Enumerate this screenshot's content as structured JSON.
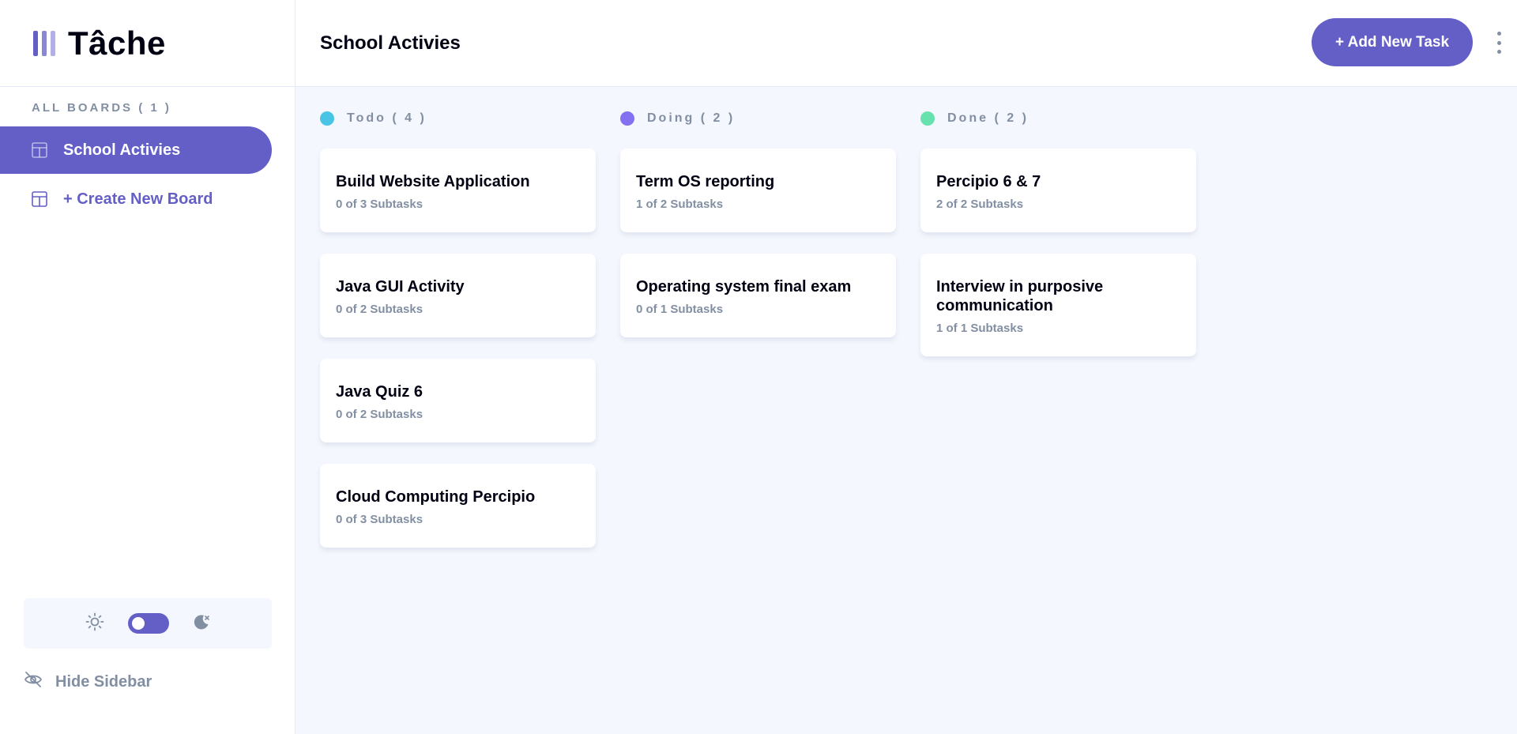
{
  "app": {
    "logo_text": "Tâche"
  },
  "sidebar": {
    "boards_heading": "ALL BOARDS ( 1 )",
    "boards": [
      {
        "label": "School Activies",
        "active": true
      }
    ],
    "create_board_label": "+ Create New Board",
    "hide_sidebar_label": "Hide Sidebar",
    "theme": {
      "light_icon": "sun-icon",
      "dark_icon": "moon-icon",
      "dark_mode": false
    }
  },
  "header": {
    "board_title": "School Activies",
    "add_task_label": "+ Add New Task",
    "menu_icon": "vertical-ellipsis-icon"
  },
  "columns": [
    {
      "name": "Todo ( 4 )",
      "color": "#49c4e5",
      "tasks": [
        {
          "title": "Build Website Application",
          "subtasks": "0 of 3 Subtasks"
        },
        {
          "title": "Java GUI Activity",
          "subtasks": "0 of 2 Subtasks"
        },
        {
          "title": "Java Quiz 6",
          "subtasks": "0 of 2 Subtasks"
        },
        {
          "title": "Cloud Computing Percipio",
          "subtasks": "0 of 3 Subtasks"
        }
      ]
    },
    {
      "name": "Doing ( 2 )",
      "color": "#8471f2",
      "tasks": [
        {
          "title": "Term OS reporting",
          "subtasks": "1 of 2 Subtasks"
        },
        {
          "title": "Operating system final exam",
          "subtasks": "0 of 1 Subtasks"
        }
      ]
    },
    {
      "name": "Done ( 2 )",
      "color": "#67e2ae",
      "tasks": [
        {
          "title": "Percipio 6 & 7",
          "subtasks": "2 of 2 Subtasks"
        },
        {
          "title": "Interview in purposive communication",
          "subtasks": "1 of 1 Subtasks"
        }
      ]
    }
  ],
  "colors": {
    "accent": "#635fc7",
    "muted": "#828fa3",
    "background": "#f4f7fd"
  }
}
